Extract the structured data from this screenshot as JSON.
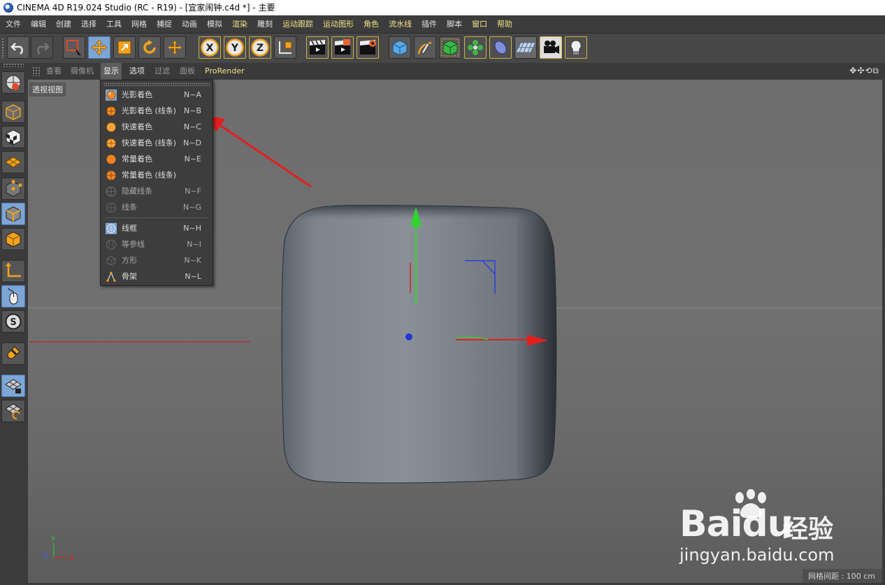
{
  "window": {
    "title": "CINEMA 4D R19.024 Studio (RC - R19) - [宜家闹钟.c4d *] - 主要"
  },
  "menubar": {
    "items": [
      "文件",
      "编辑",
      "创建",
      "选择",
      "工具",
      "网格",
      "捕捉",
      "动画",
      "模拟",
      "渲染",
      "雕刻",
      "运动跟踪",
      "运动图形",
      "角色",
      "流水线",
      "插件",
      "脚本",
      "窗口",
      "帮助"
    ]
  },
  "viewport_menu": {
    "items": [
      "查看",
      "摄像机",
      "显示",
      "选项",
      "过滤",
      "面板",
      "ProRender"
    ],
    "nav_icons": "✥✣⟲⧉"
  },
  "viewport": {
    "label": "透视视图",
    "grid_info": "网格间距 : 100 cm",
    "axis_labels": {
      "y": "Y",
      "z": "Z",
      "x": "X"
    }
  },
  "display_menu": {
    "items": [
      {
        "label": "光影着色",
        "shortcut": "N~A",
        "icon": "shaded-ball-icon"
      },
      {
        "label": "光影着色 (线条)",
        "shortcut": "N~B",
        "icon": "shaded-lines-ball-icon"
      },
      {
        "label": "快速着色",
        "shortcut": "N~C",
        "icon": "quick-shading-icon"
      },
      {
        "label": "快速着色 (线条)",
        "shortcut": "N~D",
        "icon": "quick-shading-lines-icon"
      },
      {
        "label": "常量着色",
        "shortcut": "N~E",
        "icon": "constant-shading-icon"
      },
      {
        "label": "常量着色 (线条)",
        "shortcut": "",
        "icon": "constant-shading-lines-icon"
      },
      {
        "label": "隐藏线条",
        "shortcut": "N~F",
        "icon": "hidden-line-icon"
      },
      {
        "label": "线条",
        "shortcut": "N~G",
        "icon": "lines-icon"
      },
      {
        "label": "线框",
        "shortcut": "N~H",
        "icon": "wireframe-icon"
      },
      {
        "label": "等参线",
        "shortcut": "N~I",
        "icon": "isoparm-icon"
      },
      {
        "label": "方形",
        "shortcut": "N~K",
        "icon": "box-icon"
      },
      {
        "label": "骨架",
        "shortcut": "N~L",
        "icon": "skeleton-icon"
      }
    ]
  },
  "watermark": {
    "brand": "Baidu",
    "cn": "经验",
    "url": "jingyan.baidu.com"
  },
  "colors": {
    "accent_yellow": "#f0e38a",
    "active_blue": "#7da5d6",
    "arrow_red": "#e02020"
  }
}
